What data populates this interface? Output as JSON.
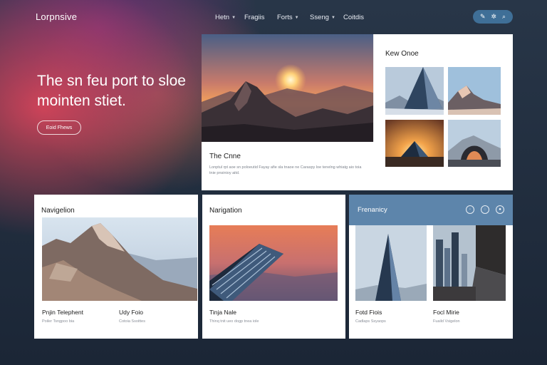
{
  "brand": "Lorpnsive",
  "nav": [
    {
      "label": "Hetn",
      "caret": true
    },
    {
      "label": "Fragiis",
      "caret": false
    },
    {
      "label": "Forts",
      "caret": true
    },
    {
      "label": "Sseng",
      "caret": true
    },
    {
      "label": "Coitdis",
      "caret": false
    }
  ],
  "header_icons": [
    "pen-icon",
    "settings-icon",
    "search-icon"
  ],
  "hero": {
    "title": "The sn feu port to sloe mointen stiet.",
    "button": "Eoid Fhews"
  },
  "feature": {
    "heading": "Kew Onoe",
    "card_title": "The Cnne",
    "card_text": "Lonptul rpt aoe sn poloeutid Fayay afie sla tnaoe ne Caraspy loe tenelng whiatg aio toia tnie pnsinioy aitd."
  },
  "cards": [
    {
      "title": "Navigelion",
      "items": [
        {
          "title": "Pnjin Telephent",
          "sub": "Poiler Tsngpoo bia"
        },
        {
          "title": "Udy Foio",
          "sub": "Cotoia Ssoittes"
        }
      ]
    },
    {
      "title": "Narigation",
      "items": [
        {
          "title": "Tinja Nale",
          "sub": "Thinq tnit ueo dogp tnea iole"
        }
      ]
    },
    {
      "title": "Frenanicy",
      "icons": [
        "chat-icon",
        "globe-icon",
        "user-icon"
      ],
      "items": [
        {
          "title": "Fotd Fiois",
          "sub": "Cadlaps Ssyaops"
        },
        {
          "title": "Focl Mirie",
          "sub": "Fuaild Vsigelon"
        }
      ]
    }
  ],
  "colors": {
    "accent": "#3f6f97",
    "frequency_bar": "#5d85ab",
    "background": "#1f2b3a",
    "glow": "#e6465a"
  }
}
